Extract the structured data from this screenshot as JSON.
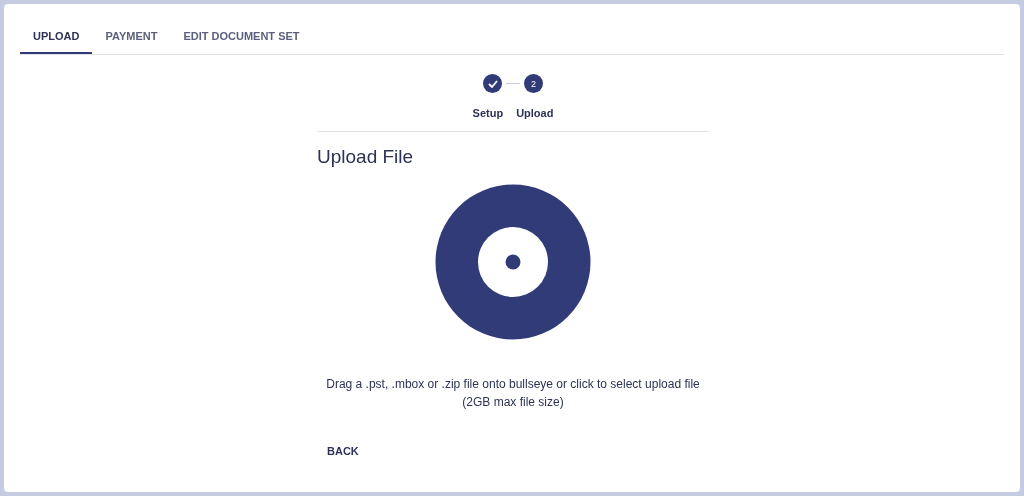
{
  "tabs": [
    {
      "label": "UPLOAD",
      "selected": true
    },
    {
      "label": "PAYMENT",
      "selected": false
    },
    {
      "label": "EDIT DOCUMENT SET",
      "selected": false
    }
  ],
  "stepper": [
    {
      "label": "Setup",
      "completed": true
    },
    {
      "label": "Upload",
      "number": "2",
      "completed": false
    }
  ],
  "title": "Upload File",
  "description": [
    "Drag a .pst, .mbox or .zip file onto bullseye or click to select upload file",
    "(2GB max file size)"
  ],
  "back_button": "BACK"
}
